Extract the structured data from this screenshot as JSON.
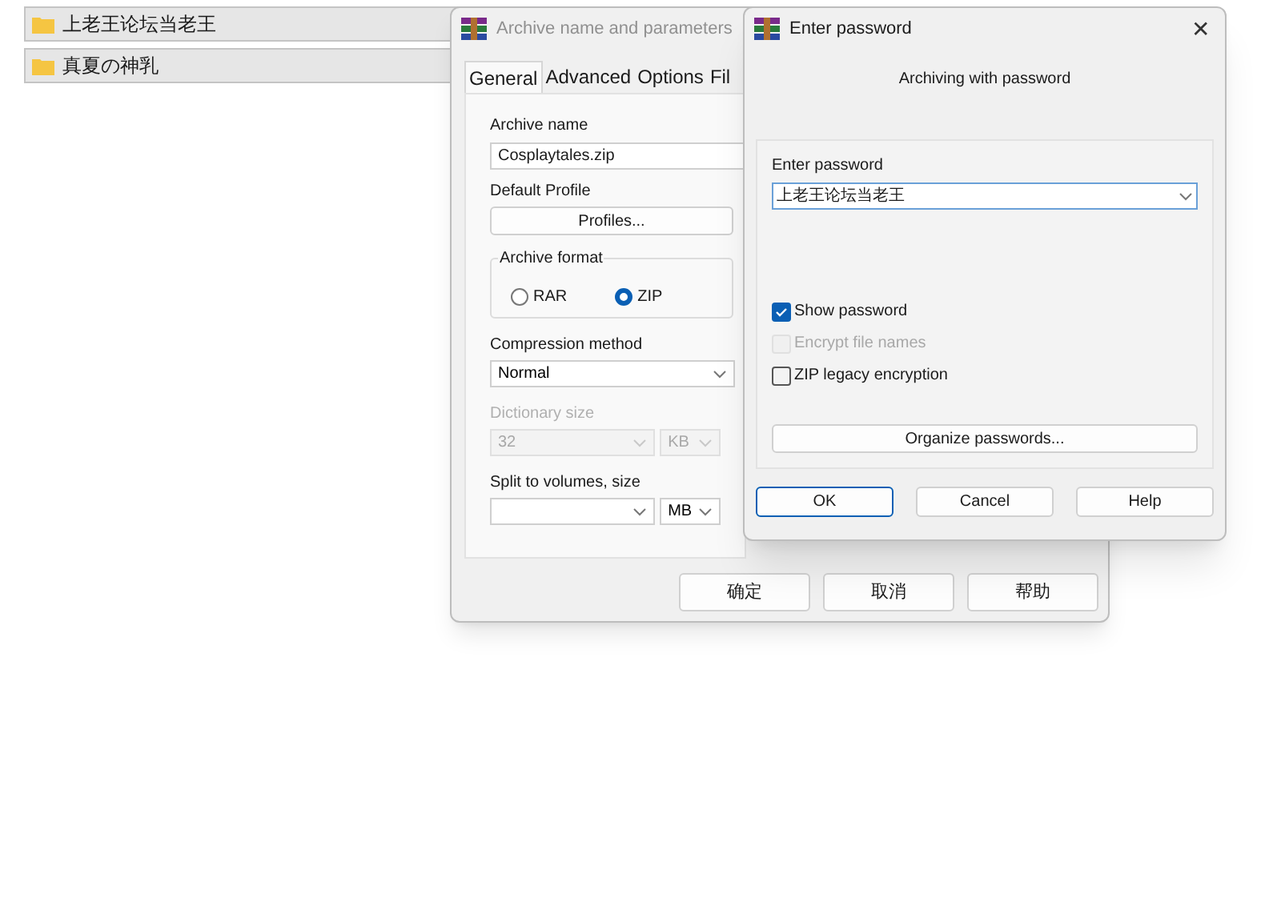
{
  "folders": [
    {
      "name": "上老王论坛当老王"
    },
    {
      "name": "真夏の神乳"
    }
  ],
  "archive_dialog": {
    "title": "Archive name and parameters",
    "tabs": [
      {
        "label": "General",
        "selected": true
      },
      {
        "label": "Advanced",
        "selected": false
      },
      {
        "label": "Options",
        "selected": false
      },
      {
        "label": "Fil",
        "selected": false
      }
    ],
    "archive_name": {
      "label": "Archive name",
      "value": "Cosplaytales.zip"
    },
    "default_profile": {
      "label": "Default Profile",
      "button": "Profiles..."
    },
    "archive_format": {
      "label": "Archive format",
      "options": [
        {
          "label": "RAR",
          "selected": false
        },
        {
          "label": "ZIP",
          "selected": true
        }
      ]
    },
    "compression_method": {
      "label": "Compression method",
      "value": "Normal",
      "disabled": false
    },
    "dictionary_size": {
      "label": "Dictionary size",
      "value": "32",
      "unit": "KB",
      "disabled": true
    },
    "split_volumes": {
      "label": "Split to volumes, size",
      "unit": "MB",
      "disabled": false
    },
    "buttons": [
      "确定",
      "取消",
      "帮助"
    ]
  },
  "password_dialog": {
    "title": "Enter password",
    "close": "✕",
    "subtitle": "Archiving with password",
    "field": {
      "label": "Enter password",
      "value": "上老王论坛当老王"
    },
    "checkboxes": [
      {
        "label": "Show password",
        "checked": true,
        "disabled": false
      },
      {
        "label": "Encrypt file names",
        "checked": false,
        "disabled": true
      },
      {
        "label": "ZIP legacy encryption",
        "checked": false,
        "disabled": false
      }
    ],
    "organize_button": "Organize passwords...",
    "buttons": [
      {
        "label": "OK",
        "selected": true
      },
      {
        "label": "Cancel",
        "selected": false
      },
      {
        "label": "Help",
        "selected": false
      }
    ]
  }
}
